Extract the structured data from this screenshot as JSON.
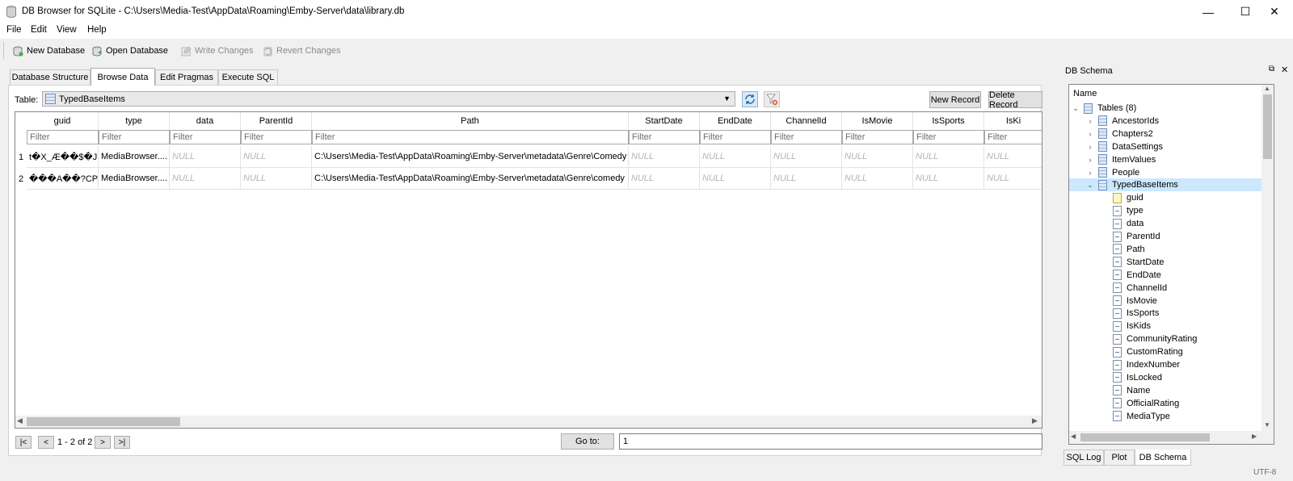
{
  "window": {
    "title": "DB Browser for SQLite - C:\\Users\\Media-Test\\AppData\\Roaming\\Emby-Server\\data\\library.db",
    "minimize": "—",
    "maximize": "☐",
    "close": "✕"
  },
  "menu": [
    "File",
    "Edit",
    "View",
    "Help"
  ],
  "toolbar": {
    "new_db": "New Database",
    "open_db": "Open Database",
    "write": "Write Changes",
    "revert": "Revert Changes"
  },
  "tabs": [
    "Database Structure",
    "Browse Data",
    "Edit Pragmas",
    "Execute SQL"
  ],
  "browse": {
    "table_label": "Table:",
    "table_value": "TypedBaseItems",
    "new_record": "New Record",
    "delete_record": "Delete Record",
    "filter_placeholder": "Filter",
    "columns": [
      "guid",
      "type",
      "data",
      "ParentId",
      "Path",
      "StartDate",
      "EndDate",
      "ChannelId",
      "IsMovie",
      "IsSports",
      "IsKi"
    ],
    "rows": [
      [
        "1",
        "t�X_Æ��$�J◻...",
        "MediaBrowser....",
        "NULL",
        "NULL",
        "C:\\Users\\Media-Test\\AppData\\Roaming\\Emby-Server\\metadata\\Genre\\Comedy",
        "NULL",
        "NULL",
        "NULL",
        "NULL",
        "NULL",
        "NULL"
      ],
      [
        "2",
        "���A��?CP...",
        "MediaBrowser....",
        "NULL",
        "NULL",
        "C:\\Users\\Media-Test\\AppData\\Roaming\\Emby-Server\\metadata\\Genre\\comedy",
        "NULL",
        "NULL",
        "NULL",
        "NULL",
        "NULL",
        "NULL"
      ]
    ],
    "nav": {
      "first": "|<",
      "prev": "<",
      "page_info": "1 - 2 of 2",
      "next": ">",
      "last": ">|",
      "goto_label": "Go to:",
      "goto_value": "1"
    }
  },
  "schema": {
    "title": "DB Schema",
    "column_header": "Name",
    "tables_node": "Tables (8)",
    "tables": [
      "AncestorIds",
      "Chapters2",
      "DataSettings",
      "ItemValues",
      "People",
      "TypedBaseItems"
    ],
    "fields": [
      "guid",
      "type",
      "data",
      "ParentId",
      "Path",
      "StartDate",
      "EndDate",
      "ChannelId",
      "IsMovie",
      "IsSports",
      "IsKids",
      "CommunityRating",
      "CustomRating",
      "IndexNumber",
      "IsLocked",
      "Name",
      "OfficialRating",
      "MediaType"
    ]
  },
  "bottom_tabs": [
    "SQL Log",
    "Plot",
    "DB Schema"
  ],
  "status": {
    "encoding": "UTF-8"
  },
  "icons": {
    "app": "database-icon",
    "new_db": "new-database-icon",
    "open_db": "open-database-icon",
    "write": "write-changes-icon",
    "revert": "revert-changes-icon",
    "refresh": "refresh-icon",
    "clear_filters": "clear-filters-icon",
    "table": "table-icon",
    "field": "field-icon",
    "key": "key-icon"
  },
  "colors": {
    "selection": "#cce8ff",
    "null_text": "#b4b4b4",
    "accent": "#0078d7"
  }
}
